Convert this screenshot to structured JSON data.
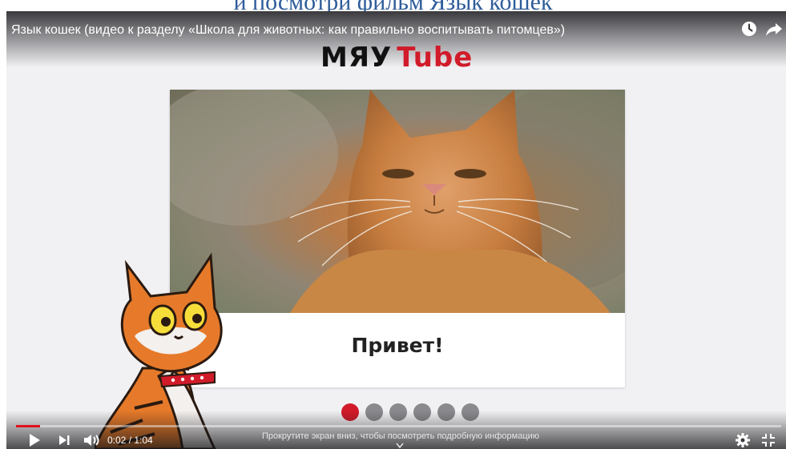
{
  "page": {
    "heading": "и посмотри фильм Язык кошек"
  },
  "player": {
    "title": "Язык кошек (видео к разделу «Школа для животных: как правильно воспитывать питомцев»)",
    "top_icons": [
      "watch-later-icon",
      "share-icon"
    ],
    "logo": {
      "part1": "МЯУ",
      "part2": "Tube",
      "part2_color": "#d11b2a"
    },
    "slide": {
      "caption": "Привет!",
      "image": "ginger-cat-photo"
    },
    "slide_indicator": {
      "count": 6,
      "active_index": 0,
      "active_color": "#d11b2a",
      "inactive_color": "#8a8a8e"
    },
    "controls": {
      "current_time": "0:02",
      "duration": "1:04",
      "time_display": "0:02 / 1:04",
      "progress_fraction": 0.03125,
      "progress_color": "#e0121d",
      "scroll_hint": "Прокрутите экран вниз, чтобы посмотреть подробную информацию",
      "buttons": [
        "play-icon",
        "next-icon",
        "volume-icon",
        "settings-icon",
        "exit-fullscreen-icon"
      ]
    }
  }
}
